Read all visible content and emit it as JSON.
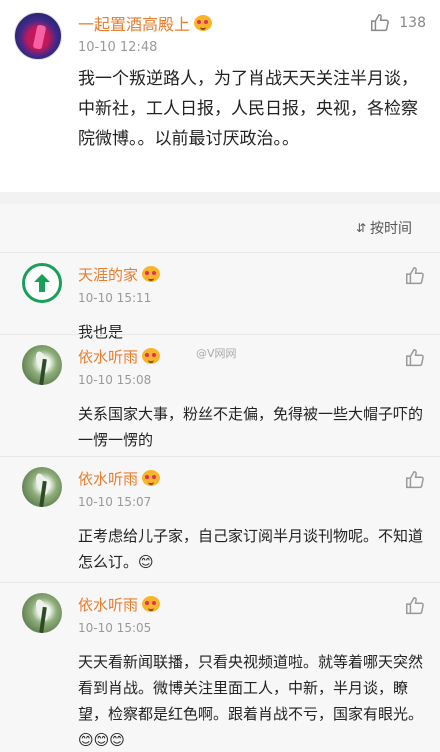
{
  "post": {
    "author": "一起置酒高殿上",
    "time": "10-10 12:48",
    "likes": "138",
    "content": "我一个叛逆路人，为了肖战天天关注半月谈，中新社，工人日报，人民日报，央视，各检察院微博。。以前最讨厌政治。。"
  },
  "sort": {
    "label": "按时间"
  },
  "watermark": "@V网网",
  "comments": [
    {
      "name": "天涯的家",
      "time": "10-10 15:11",
      "text": "我也是"
    },
    {
      "name": "依水听雨",
      "time": "10-10 15:08",
      "text": "关系国家大事，粉丝不走偏，免得被一些大帽子吓的一愣一愣的"
    },
    {
      "name": "依水听雨",
      "time": "10-10 15:07",
      "text": "正考虑给儿子家，自己家订阅半月谈刊物呢。不知道怎么订。😊"
    },
    {
      "name": "依水听雨",
      "time": "10-10 15:05",
      "text": "天天看新闻联播，只看央视频道啦。就等着哪天突然看到肖战。微博关注里面工人，中新，半月谈，瞭望，检察都是红色啊。跟着肖战不亏，国家有眼光。😊😊😊"
    }
  ]
}
